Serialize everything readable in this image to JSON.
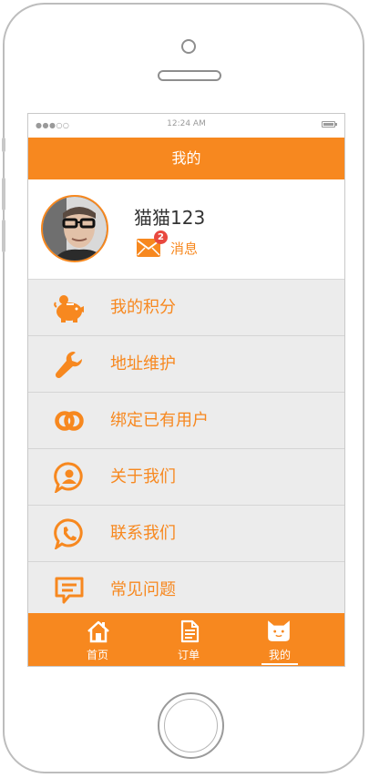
{
  "status_bar": {
    "signal": "●●●○○",
    "time": "12:24 AM"
  },
  "header": {
    "title": "我的"
  },
  "profile": {
    "username": "猫猫123",
    "message_label": "消息",
    "message_badge": "2"
  },
  "menu": [
    {
      "label": "我的积分",
      "icon": "piggy-bank-icon"
    },
    {
      "label": "地址维护",
      "icon": "wrench-icon"
    },
    {
      "label": "绑定已有用户",
      "icon": "link-rings-icon"
    },
    {
      "label": "关于我们",
      "icon": "user-bubble-icon"
    },
    {
      "label": "联系我们",
      "icon": "phone-bubble-icon"
    },
    {
      "label": "常见问题",
      "icon": "chat-lines-icon"
    }
  ],
  "tabs": [
    {
      "label": "首页",
      "icon": "home-icon"
    },
    {
      "label": "订单",
      "icon": "document-icon"
    },
    {
      "label": "我的",
      "icon": "cat-face-icon",
      "active": true
    }
  ],
  "colors": {
    "accent": "#f7881f",
    "background": "#ececec",
    "badge": "#e8483f"
  }
}
